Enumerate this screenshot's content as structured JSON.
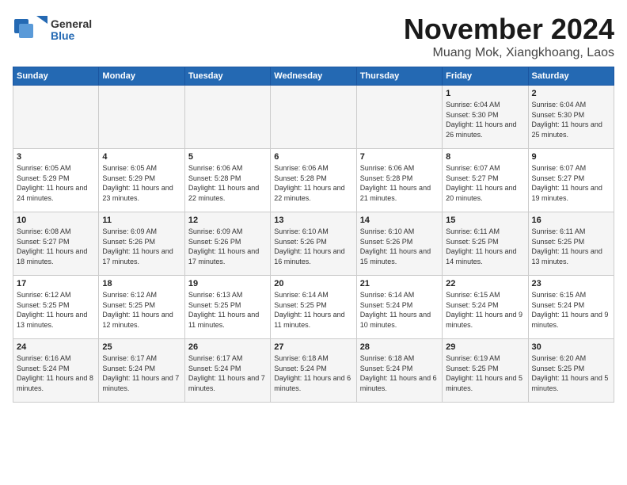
{
  "header": {
    "logo_general": "General",
    "logo_blue": "Blue",
    "month_title": "November 2024",
    "location": "Muang Mok, Xiangkhoang, Laos"
  },
  "days_of_week": [
    "Sunday",
    "Monday",
    "Tuesday",
    "Wednesday",
    "Thursday",
    "Friday",
    "Saturday"
  ],
  "weeks": [
    [
      {
        "day": "",
        "info": ""
      },
      {
        "day": "",
        "info": ""
      },
      {
        "day": "",
        "info": ""
      },
      {
        "day": "",
        "info": ""
      },
      {
        "day": "",
        "info": ""
      },
      {
        "day": "1",
        "info": "Sunrise: 6:04 AM\nSunset: 5:30 PM\nDaylight: 11 hours and 26 minutes."
      },
      {
        "day": "2",
        "info": "Sunrise: 6:04 AM\nSunset: 5:30 PM\nDaylight: 11 hours and 25 minutes."
      }
    ],
    [
      {
        "day": "3",
        "info": "Sunrise: 6:05 AM\nSunset: 5:29 PM\nDaylight: 11 hours and 24 minutes."
      },
      {
        "day": "4",
        "info": "Sunrise: 6:05 AM\nSunset: 5:29 PM\nDaylight: 11 hours and 23 minutes."
      },
      {
        "day": "5",
        "info": "Sunrise: 6:06 AM\nSunset: 5:28 PM\nDaylight: 11 hours and 22 minutes."
      },
      {
        "day": "6",
        "info": "Sunrise: 6:06 AM\nSunset: 5:28 PM\nDaylight: 11 hours and 22 minutes."
      },
      {
        "day": "7",
        "info": "Sunrise: 6:06 AM\nSunset: 5:28 PM\nDaylight: 11 hours and 21 minutes."
      },
      {
        "day": "8",
        "info": "Sunrise: 6:07 AM\nSunset: 5:27 PM\nDaylight: 11 hours and 20 minutes."
      },
      {
        "day": "9",
        "info": "Sunrise: 6:07 AM\nSunset: 5:27 PM\nDaylight: 11 hours and 19 minutes."
      }
    ],
    [
      {
        "day": "10",
        "info": "Sunrise: 6:08 AM\nSunset: 5:27 PM\nDaylight: 11 hours and 18 minutes."
      },
      {
        "day": "11",
        "info": "Sunrise: 6:09 AM\nSunset: 5:26 PM\nDaylight: 11 hours and 17 minutes."
      },
      {
        "day": "12",
        "info": "Sunrise: 6:09 AM\nSunset: 5:26 PM\nDaylight: 11 hours and 17 minutes."
      },
      {
        "day": "13",
        "info": "Sunrise: 6:10 AM\nSunset: 5:26 PM\nDaylight: 11 hours and 16 minutes."
      },
      {
        "day": "14",
        "info": "Sunrise: 6:10 AM\nSunset: 5:26 PM\nDaylight: 11 hours and 15 minutes."
      },
      {
        "day": "15",
        "info": "Sunrise: 6:11 AM\nSunset: 5:25 PM\nDaylight: 11 hours and 14 minutes."
      },
      {
        "day": "16",
        "info": "Sunrise: 6:11 AM\nSunset: 5:25 PM\nDaylight: 11 hours and 13 minutes."
      }
    ],
    [
      {
        "day": "17",
        "info": "Sunrise: 6:12 AM\nSunset: 5:25 PM\nDaylight: 11 hours and 13 minutes."
      },
      {
        "day": "18",
        "info": "Sunrise: 6:12 AM\nSunset: 5:25 PM\nDaylight: 11 hours and 12 minutes."
      },
      {
        "day": "19",
        "info": "Sunrise: 6:13 AM\nSunset: 5:25 PM\nDaylight: 11 hours and 11 minutes."
      },
      {
        "day": "20",
        "info": "Sunrise: 6:14 AM\nSunset: 5:25 PM\nDaylight: 11 hours and 11 minutes."
      },
      {
        "day": "21",
        "info": "Sunrise: 6:14 AM\nSunset: 5:24 PM\nDaylight: 11 hours and 10 minutes."
      },
      {
        "day": "22",
        "info": "Sunrise: 6:15 AM\nSunset: 5:24 PM\nDaylight: 11 hours and 9 minutes."
      },
      {
        "day": "23",
        "info": "Sunrise: 6:15 AM\nSunset: 5:24 PM\nDaylight: 11 hours and 9 minutes."
      }
    ],
    [
      {
        "day": "24",
        "info": "Sunrise: 6:16 AM\nSunset: 5:24 PM\nDaylight: 11 hours and 8 minutes."
      },
      {
        "day": "25",
        "info": "Sunrise: 6:17 AM\nSunset: 5:24 PM\nDaylight: 11 hours and 7 minutes."
      },
      {
        "day": "26",
        "info": "Sunrise: 6:17 AM\nSunset: 5:24 PM\nDaylight: 11 hours and 7 minutes."
      },
      {
        "day": "27",
        "info": "Sunrise: 6:18 AM\nSunset: 5:24 PM\nDaylight: 11 hours and 6 minutes."
      },
      {
        "day": "28",
        "info": "Sunrise: 6:18 AM\nSunset: 5:24 PM\nDaylight: 11 hours and 6 minutes."
      },
      {
        "day": "29",
        "info": "Sunrise: 6:19 AM\nSunset: 5:25 PM\nDaylight: 11 hours and 5 minutes."
      },
      {
        "day": "30",
        "info": "Sunrise: 6:20 AM\nSunset: 5:25 PM\nDaylight: 11 hours and 5 minutes."
      }
    ]
  ]
}
